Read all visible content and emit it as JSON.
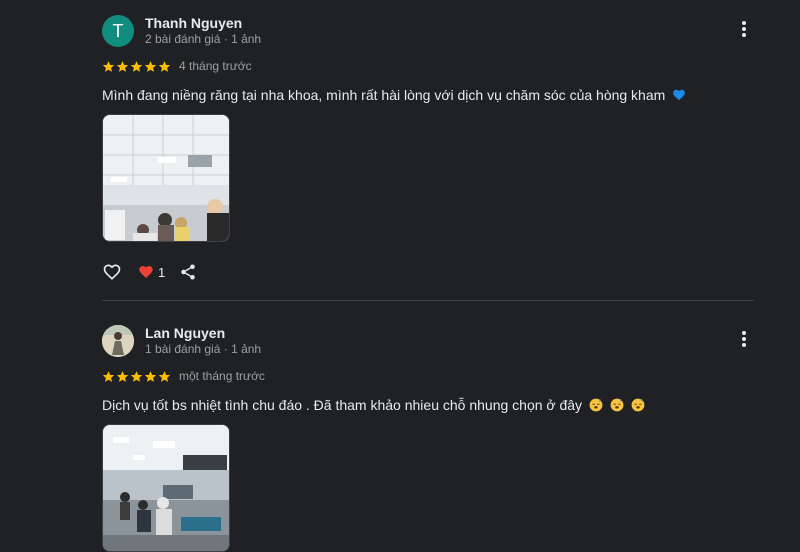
{
  "reviews": [
    {
      "avatar_letter": "T",
      "name": "Thanh Nguyen",
      "meta": "2 bài đánh giá · 1 ảnh",
      "rating": 5,
      "time": "4 tháng trước",
      "text": "Mình đang niềng răng tại nha khoa, mình rất hài lòng với dịch vụ chăm sóc của hòng kham",
      "text_emoji": "blue-heart",
      "likes": "1"
    },
    {
      "name": "Lan Nguyen",
      "meta": "1 bài đánh giá · 1 ảnh",
      "rating": 5,
      "time": "một tháng trước",
      "text": "Dịch vụ tốt bs nhiệt tình chu đáo . Đã tham khảo nhieu chỗ nhung chọn ở đây",
      "text_emoji": "sleepy-face"
    }
  ],
  "colors": {
    "background": "#202124",
    "star": "#fbbc04",
    "avatar_bg": "#128c7e",
    "liked_heart": "#ea4335"
  }
}
